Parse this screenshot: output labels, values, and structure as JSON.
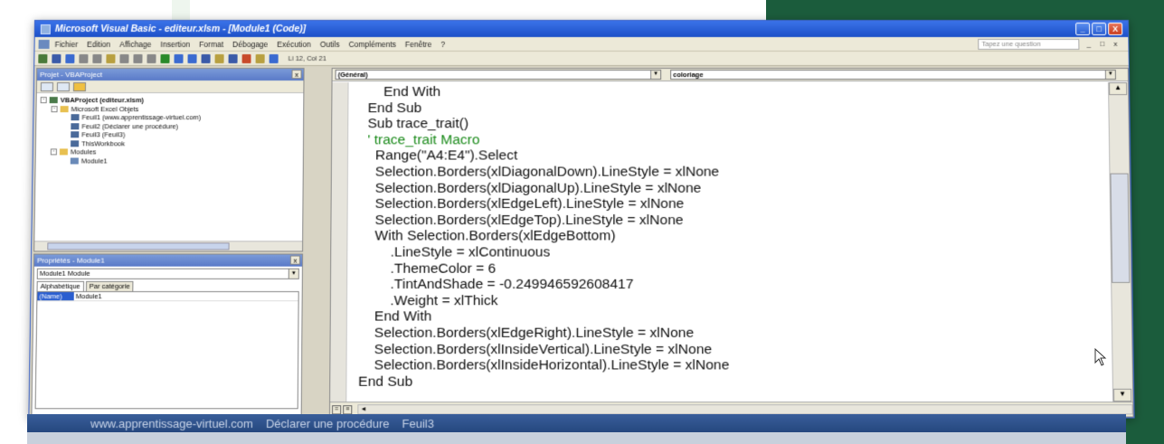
{
  "window": {
    "title": "Microsoft Visual Basic - editeur.xlsm - [Module1 (Code)]",
    "minimize_label": "_",
    "restore_label": "□",
    "close_label": "X"
  },
  "menu": {
    "items": [
      "Fichier",
      "Edition",
      "Affichage",
      "Insertion",
      "Format",
      "Débogage",
      "Exécution",
      "Outils",
      "Compléments",
      "Fenêtre",
      "?"
    ],
    "question_placeholder": "Tapez une question",
    "mdi_controls": "_ □ x"
  },
  "toolbar": {
    "cursor_position": "Li 12, Col 21"
  },
  "project_pane": {
    "title": "Projet - VBAProject",
    "close_label": "x",
    "tree": [
      {
        "label": "VBAProject (editeur.xlsm)",
        "level": 0,
        "bold": true,
        "toggle": "-",
        "icon": "project-icon"
      },
      {
        "label": "Microsoft Excel Objets",
        "level": 1,
        "bold": false,
        "toggle": "-",
        "icon": "folder-icon"
      },
      {
        "label": "Feuil1 (www.apprentissage-virtuel.com)",
        "level": 2,
        "bold": false,
        "toggle": "",
        "icon": "sheet-icon"
      },
      {
        "label": "Feuil2 (Déclarer une procédure)",
        "level": 2,
        "bold": false,
        "toggle": "",
        "icon": "sheet-icon"
      },
      {
        "label": "Feuil3 (Feuil3)",
        "level": 2,
        "bold": false,
        "toggle": "",
        "icon": "sheet-icon"
      },
      {
        "label": "ThisWorkbook",
        "level": 2,
        "bold": false,
        "toggle": "",
        "icon": "workbook-icon"
      },
      {
        "label": "Modules",
        "level": 1,
        "bold": false,
        "toggle": "-",
        "icon": "folder-icon"
      },
      {
        "label": "Module1",
        "level": 2,
        "bold": false,
        "toggle": "",
        "icon": "module-icon"
      }
    ]
  },
  "properties_pane": {
    "title": "Propriétés - Module1",
    "close_label": "x",
    "object_combo": "Module1 Module",
    "tabs": [
      "Alphabétique",
      "Par catégorie"
    ],
    "rows": [
      {
        "key": "(Name)",
        "value": "Module1"
      }
    ]
  },
  "code_window": {
    "object_combo": "(Général)",
    "procedure_combo": "coloriage",
    "lines": [
      {
        "text": "        End With",
        "type": "code"
      },
      {
        "text": "    End Sub",
        "type": "code"
      },
      {
        "text": "    Sub trace_trait()",
        "type": "code"
      },
      {
        "text": "    ' trace_trait Macro",
        "type": "comment"
      },
      {
        "text": "      Range(\"A4:E4\").Select",
        "type": "code"
      },
      {
        "text": "      Selection.Borders(xlDiagonalDown).LineStyle = xlNone",
        "type": "code"
      },
      {
        "text": "      Selection.Borders(xlDiagonalUp).LineStyle = xlNone",
        "type": "code"
      },
      {
        "text": "      Selection.Borders(xlEdgeLeft).LineStyle = xlNone",
        "type": "code"
      },
      {
        "text": "      Selection.Borders(xlEdgeTop).LineStyle = xlNone",
        "type": "code"
      },
      {
        "text": "      With Selection.Borders(xlEdgeBottom)",
        "type": "code"
      },
      {
        "text": "          .LineStyle = xlContinuous",
        "type": "code"
      },
      {
        "text": "          .ThemeColor = 6",
        "type": "code"
      },
      {
        "text": "          .TintAndShade = -0.249946592608417",
        "type": "code"
      },
      {
        "text": "          .Weight = xlThick",
        "type": "code"
      },
      {
        "text": "      End With",
        "type": "code"
      },
      {
        "text": "      Selection.Borders(xlEdgeRight).LineStyle = xlNone",
        "type": "code"
      },
      {
        "text": "      Selection.Borders(xlInsideVertical).LineStyle = xlNone",
        "type": "code"
      },
      {
        "text": "      Selection.Borders(xlInsideHorizontal).LineStyle = xlNone",
        "type": "code"
      },
      {
        "text": "  End Sub",
        "type": "code"
      }
    ]
  },
  "taskbar": {
    "tabs": [
      "www.apprentissage-virtuel.com",
      "Déclarer une procédure",
      "Feuil3"
    ]
  },
  "colors": {
    "titlebar": "#1c50c8",
    "comment": "#1a8a1a",
    "background_accent": "#1b5c3c"
  }
}
